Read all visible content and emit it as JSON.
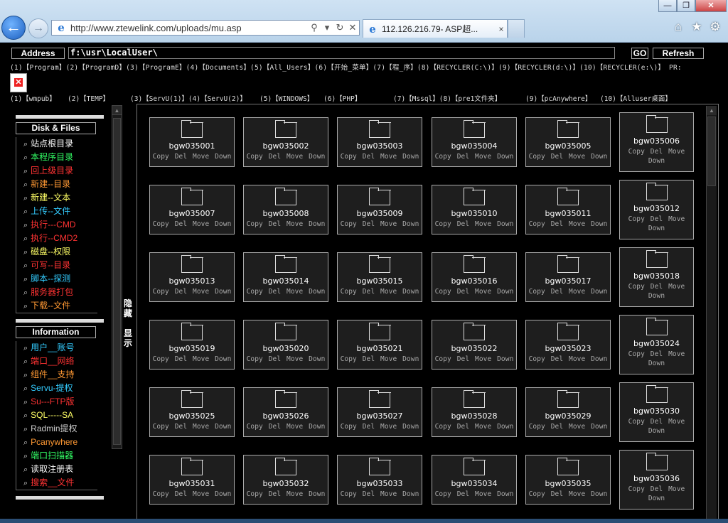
{
  "browser": {
    "url": "http://www.ztewelink.com/uploads/mu.asp",
    "tab_title": "112.126.216.79- ASP超...",
    "tab_close": "×"
  },
  "page": {
    "address_label": "Address",
    "address_value": "f:\\usr\\LocalUser\\",
    "go_label": "GO",
    "refresh_label": "Refresh",
    "quick_links_1": "(1)【Program】(2)【ProgramD】(3)【ProgramE】(4)【Documents】(5)【All_Users】(6)【开始_菜单】(7)【程_序】(8)【RECYCLER(C:\\)】(9)【RECYCLER(d:\\)】(10)【RECYCLER(e:\\)】 PR:",
    "quick_links_2": [
      "(1)【wmpub】",
      "(2)【TEMP】",
      "(3)【ServU(1)】(4)【ServU(2)】",
      "(5)【WINDOWS】",
      "(6)【PHP】",
      "(7)【Mssql】(8)【pre1文件夹】",
      "(9)【pcAnywhere】",
      "(10)【Alluser桌面】"
    ],
    "toggle_hide": "隐藏",
    "toggle_show": "显示"
  },
  "sidebar": {
    "disk_title": "Disk & Files",
    "disk_items": [
      {
        "label": "站点根目录",
        "color": "#ffffff"
      },
      {
        "label": "本程序目录",
        "color": "#33ff66"
      },
      {
        "label": "回上级目录",
        "color": "#ff3333"
      },
      {
        "label": "新建--目录",
        "color": "#ff9933"
      },
      {
        "label": "新建--文本",
        "color": "#ffff66"
      },
      {
        "label": "上传--文件",
        "color": "#33ccff"
      },
      {
        "label": "执行---CMD",
        "color": "#ff3333"
      },
      {
        "label": "执行--CMD2",
        "color": "#ff3333"
      },
      {
        "label": "磁盘--权限",
        "color": "#ffff66"
      },
      {
        "label": "可写--目录",
        "color": "#ff3333"
      },
      {
        "label": "脚本--探测",
        "color": "#33ccff"
      },
      {
        "label": "服务器打包",
        "color": "#ff3333"
      },
      {
        "label": "下载--文件",
        "color": "#ff9933"
      }
    ],
    "info_title": "Information",
    "info_items": [
      {
        "label": "用户__账号",
        "color": "#33ccff"
      },
      {
        "label": "端口__网络",
        "color": "#ff3333"
      },
      {
        "label": "组件__支持",
        "color": "#ff9933"
      },
      {
        "label": "Servu-提权",
        "color": "#33ccff"
      },
      {
        "label": "Su---FTP版",
        "color": "#ff3333"
      },
      {
        "label": "SQL-----SA",
        "color": "#ffff66"
      },
      {
        "label": "Radmin提权",
        "color": "#cccccc"
      },
      {
        "label": "Pcanywhere",
        "color": "#ff9933"
      },
      {
        "label": "端口扫描器",
        "color": "#33ff66"
      },
      {
        "label": "读取注册表",
        "color": "#ffffff"
      },
      {
        "label": "搜索__文件",
        "color": "#ff3333"
      }
    ]
  },
  "files": {
    "actions": [
      "Copy",
      "Del",
      "Move",
      "Down"
    ],
    "names": [
      "bgw035001",
      "bgw035002",
      "bgw035003",
      "bgw035004",
      "bgw035005",
      "bgw035006",
      "bgw035007",
      "bgw035008",
      "bgw035009",
      "bgw035010",
      "bgw035011",
      "bgw035012",
      "bgw035013",
      "bgw035014",
      "bgw035015",
      "bgw035016",
      "bgw035017",
      "bgw035018",
      "bgw035019",
      "bgw035020",
      "bgw035021",
      "bgw035022",
      "bgw035023",
      "bgw035024",
      "bgw035025",
      "bgw035026",
      "bgw035027",
      "bgw035028",
      "bgw035029",
      "bgw035030",
      "bgw035031",
      "bgw035032",
      "bgw035033",
      "bgw035034",
      "bgw035035",
      "bgw035036"
    ]
  }
}
